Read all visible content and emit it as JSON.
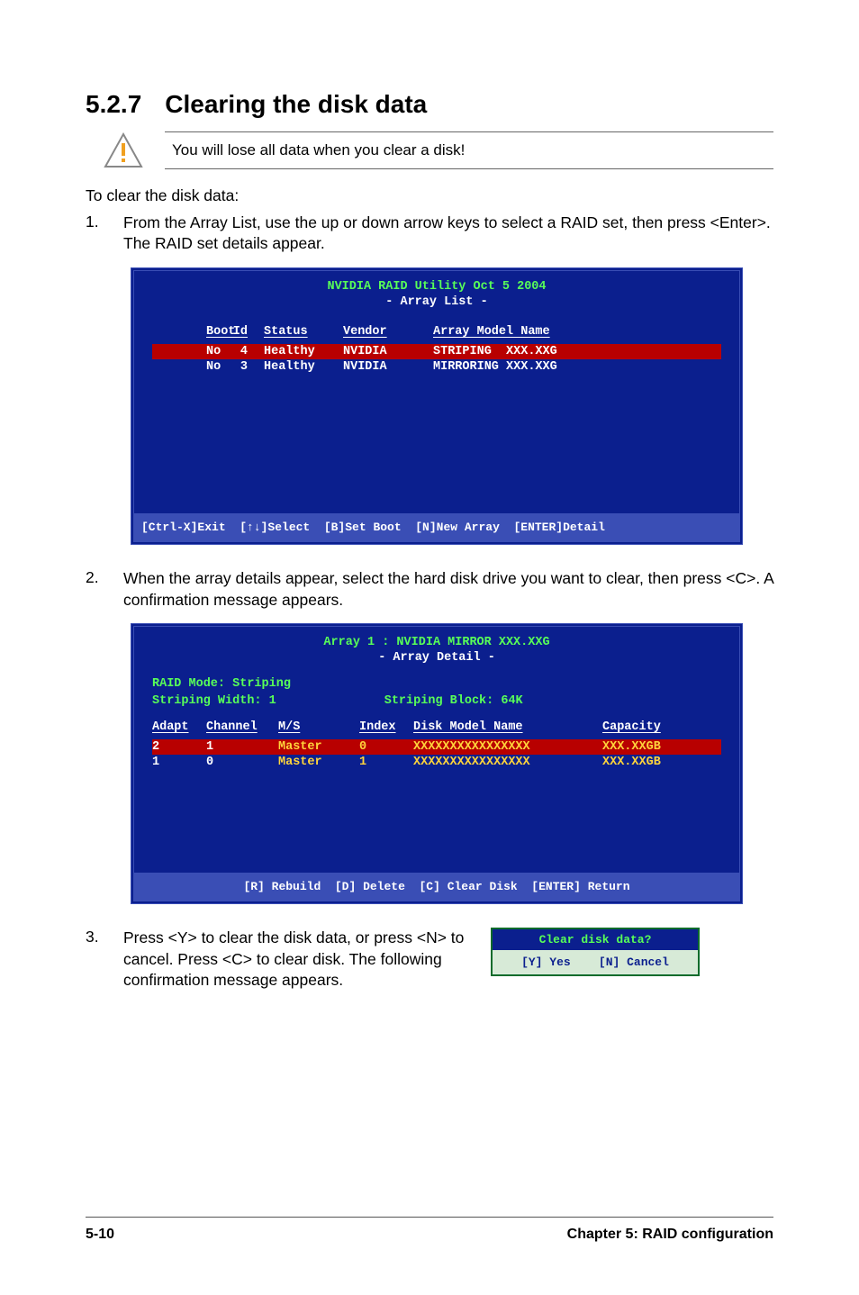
{
  "heading": {
    "number": "5.2.7",
    "title": "Clearing the disk data"
  },
  "warning": "You will lose all data when you clear a disk!",
  "intro": "To clear the disk data:",
  "steps": {
    "s1": {
      "n": "1.",
      "t": "From the Array List, use the up or down arrow keys to select a RAID set, then press <Enter>. The RAID set details appear."
    },
    "s2": {
      "n": "2.",
      "t": "When the array details appear, select the hard disk drive you want to clear, then press <C>. A confirmation message appears."
    },
    "s3": {
      "n": "3.",
      "t": "Press <Y> to clear the disk data, or press <N> to cancel. Press <C> to clear disk. The following confirmation message appears."
    }
  },
  "bios1": {
    "title": "NVIDIA RAID Utility  Oct 5 2004",
    "subtitle": "- Array List -",
    "headers": {
      "boot": "Boot",
      "id": "Id",
      "status": "Status",
      "vendor": "Vendor",
      "arr": "Array Model Name"
    },
    "rows": [
      {
        "boot": "No",
        "id": "4",
        "status": "Healthy",
        "vendor": "NVIDIA",
        "arr": "STRIPING  XXX.XXG",
        "sel": true
      },
      {
        "boot": "No",
        "id": "3",
        "status": "Healthy",
        "vendor": "NVIDIA",
        "arr": "MIRRORING XXX.XXG",
        "sel": false
      }
    ],
    "footer": "[Ctrl-X]Exit  [↑↓]Select  [B]Set Boot  [N]New Array  [ENTER]Detail"
  },
  "bios2": {
    "title": "Array 1 : NVIDIA MIRROR  XXX.XXG",
    "subtitle": "- Array Detail -",
    "mode": "RAID Mode: Striping",
    "width": "Striping Width: 1",
    "block": "Striping Block: 64K",
    "headers": {
      "adapt": "Adapt",
      "chan": "Channel",
      "ms": "M/S",
      "idx": "Index",
      "disk": "Disk Model Name",
      "cap": "Capacity"
    },
    "rows": [
      {
        "adapt": "2",
        "chan": "1",
        "ms": "Master",
        "idx": "0",
        "disk": "XXXXXXXXXXXXXXXX",
        "cap": "XXX.XXGB",
        "sel": true
      },
      {
        "adapt": "1",
        "chan": "0",
        "ms": "Master",
        "idx": "1",
        "disk": "XXXXXXXXXXXXXXXX",
        "cap": "XXX.XXGB",
        "sel": false
      }
    ],
    "footer": "[R] Rebuild  [D] Delete  [C] Clear Disk  [ENTER] Return"
  },
  "confirm": {
    "title": "Clear disk data?",
    "body": "[Y] Yes    [N] Cancel"
  },
  "footer": {
    "left": "5-10",
    "right": "Chapter 5: RAID configuration"
  },
  "chart_data": {
    "type": "table",
    "tables": [
      {
        "title": "NVIDIA RAID Utility – Array List",
        "columns": [
          "Boot",
          "Id",
          "Status",
          "Vendor",
          "Array Model Name"
        ],
        "rows": [
          [
            "No",
            4,
            "Healthy",
            "NVIDIA",
            "STRIPING XXX.XXG"
          ],
          [
            "No",
            3,
            "Healthy",
            "NVIDIA",
            "MIRRORING XXX.XXG"
          ]
        ]
      },
      {
        "title": "Array 1 : NVIDIA MIRROR XXX.XXG – Array Detail",
        "meta": {
          "RAID Mode": "Striping",
          "Striping Width": 1,
          "Striping Block": "64K"
        },
        "columns": [
          "Adapt",
          "Channel",
          "M/S",
          "Index",
          "Disk Model Name",
          "Capacity"
        ],
        "rows": [
          [
            2,
            1,
            "Master",
            0,
            "XXXXXXXXXXXXXXXX",
            "XXX.XXGB"
          ],
          [
            1,
            0,
            "Master",
            1,
            "XXXXXXXXXXXXXXXX",
            "XXX.XXGB"
          ]
        ]
      }
    ]
  }
}
